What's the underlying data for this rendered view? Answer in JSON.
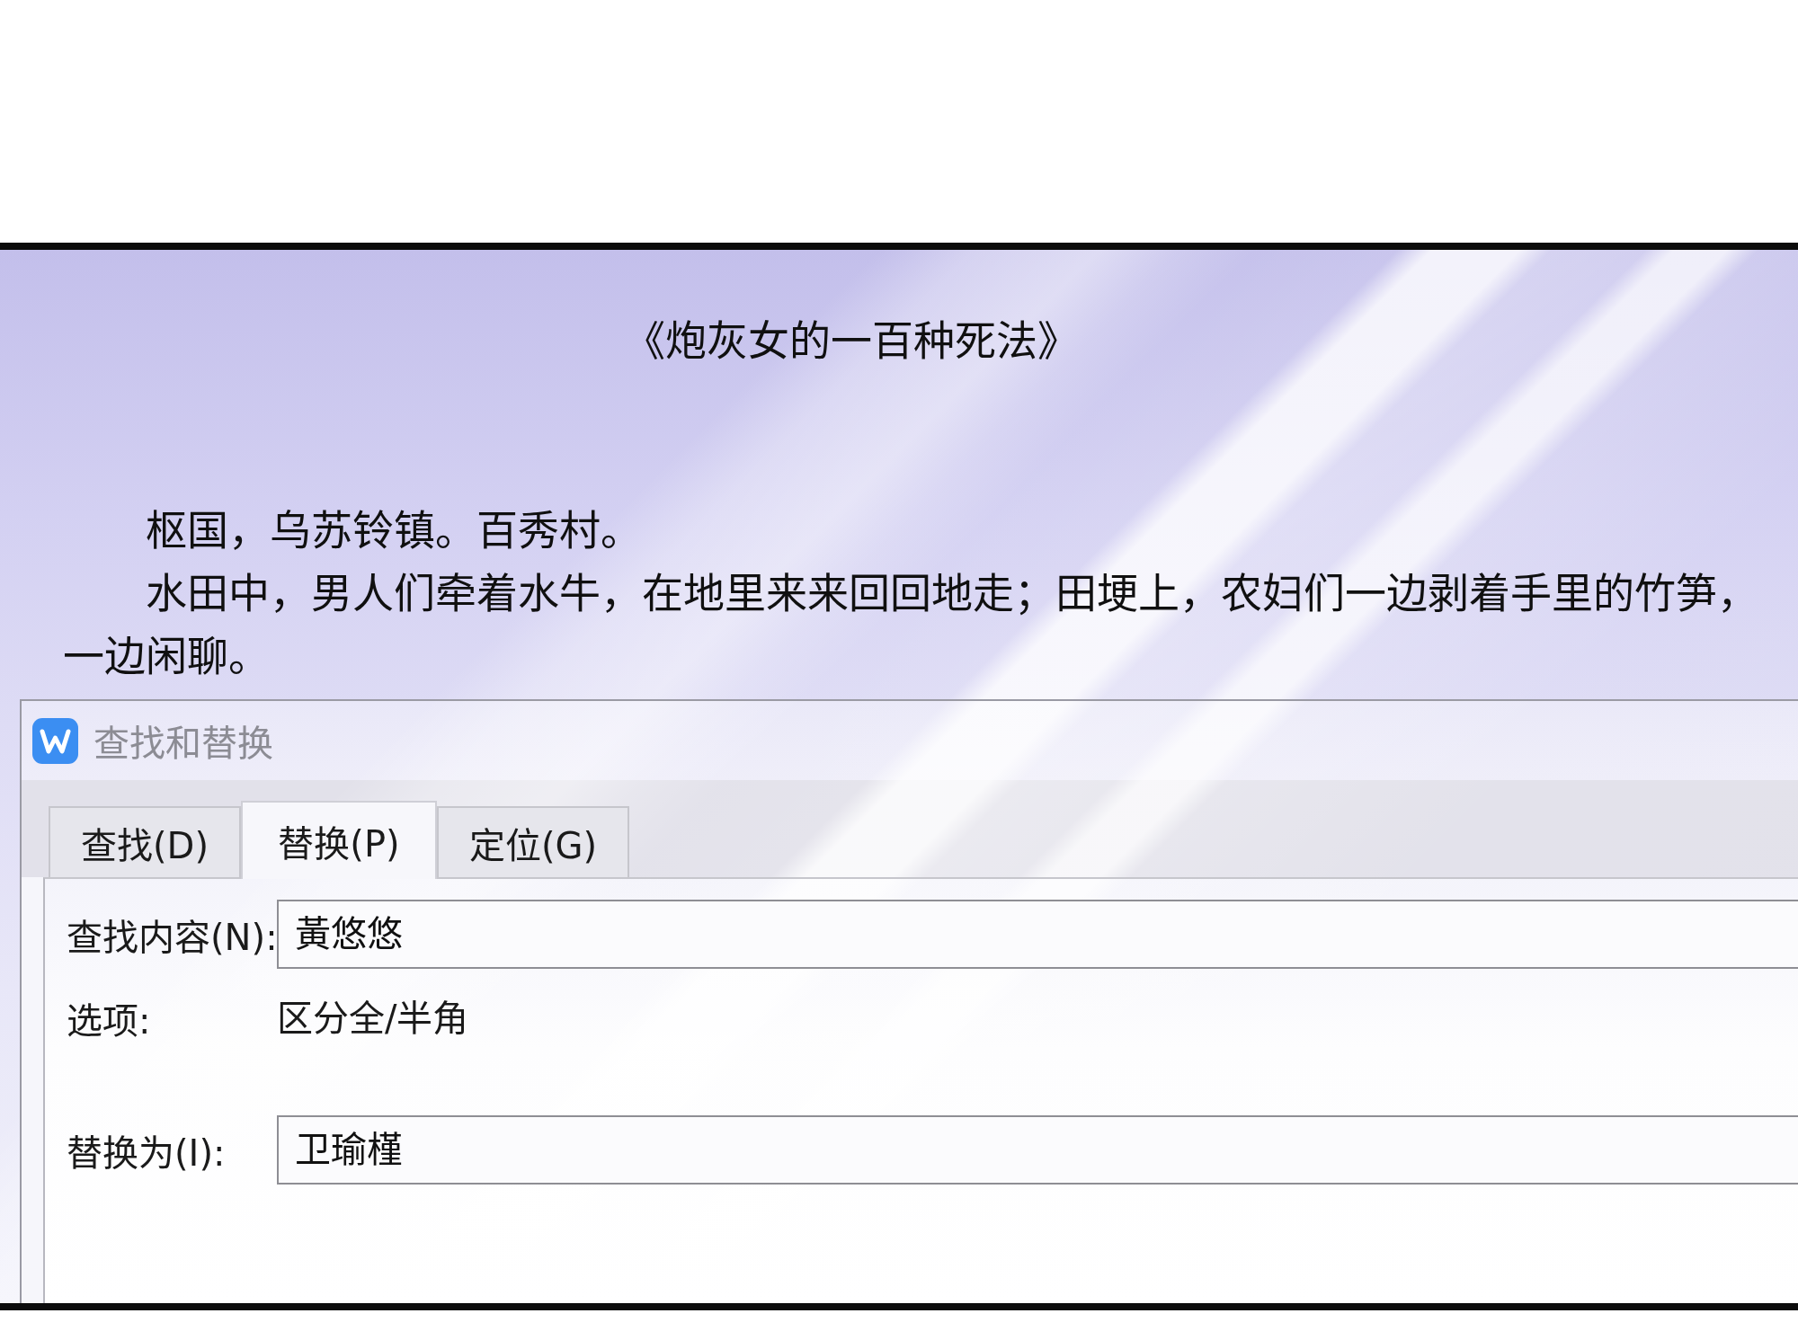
{
  "document": {
    "title": "《炮灰女的一百种死法》",
    "paragraphs": [
      "枢国，乌苏铃镇。百秀村。",
      "水田中，男人们牵着水牛，在地里来来回回地走；田埂上，农妇们一边剥着手里的竹笋，一边闲聊。"
    ]
  },
  "dialog": {
    "title": "查找和替换",
    "tabs": [
      {
        "label": "查找(D)",
        "selected": false
      },
      {
        "label": "替换(P)",
        "selected": true
      },
      {
        "label": "定位(G)",
        "selected": false
      }
    ],
    "rows": [
      {
        "kind": "input",
        "label": "查找内容(N):",
        "value": "黃悠悠"
      },
      {
        "kind": "text",
        "label": "选项:",
        "value": "区分全/半角"
      },
      {
        "kind": "input",
        "label": "替换为(I):",
        "value": "卫瑜槿"
      }
    ]
  }
}
